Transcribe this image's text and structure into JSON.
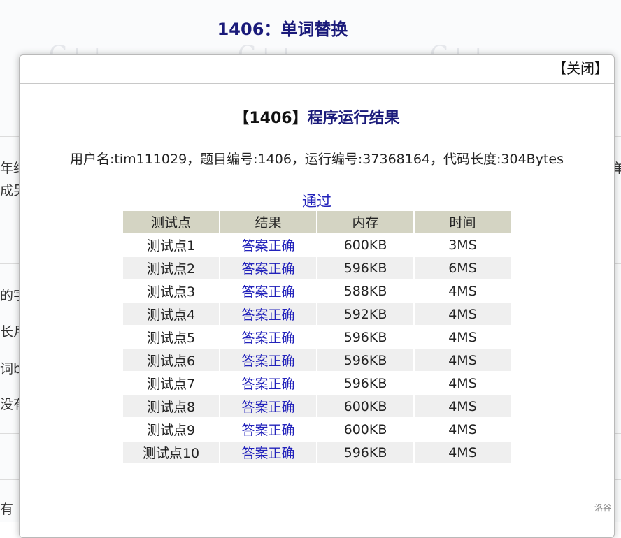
{
  "background": {
    "problem_title": "1406：单词替换",
    "watermark": "C++",
    "left_fragments": [
      "年结",
      "成另",
      "的字",
      "长月",
      "词b",
      "没有",
      "有"
    ],
    "right_fragment": "单"
  },
  "modal": {
    "close_label": "【关闭】",
    "heading_prefix": "【1406】",
    "heading_title": "程序运行结果",
    "submission_info": "用户名:tim111029，题目编号:1406，运行编号:37368164，代码长度:304Bytes",
    "verdict": "通过",
    "table": {
      "headers": [
        "测试点",
        "结果",
        "内存",
        "时间"
      ],
      "rows": [
        [
          "测试点1",
          "答案正确",
          "600KB",
          "3MS"
        ],
        [
          "测试点2",
          "答案正确",
          "596KB",
          "6MS"
        ],
        [
          "测试点3",
          "答案正确",
          "588KB",
          "4MS"
        ],
        [
          "测试点4",
          "答案正确",
          "592KB",
          "4MS"
        ],
        [
          "测试点5",
          "答案正确",
          "596KB",
          "4MS"
        ],
        [
          "测试点6",
          "答案正确",
          "596KB",
          "4MS"
        ],
        [
          "测试点7",
          "答案正确",
          "596KB",
          "4MS"
        ],
        [
          "测试点8",
          "答案正确",
          "600KB",
          "4MS"
        ],
        [
          "测试点9",
          "答案正确",
          "600KB",
          "4MS"
        ],
        [
          "测试点10",
          "答案正确",
          "596KB",
          "4MS"
        ]
      ]
    }
  },
  "footer_mark": "洛谷",
  "colors": {
    "accent": "#2222bb",
    "title": "#1a1a7a",
    "header_bg": "#d4d4c3",
    "alt_row": "#efefef"
  }
}
